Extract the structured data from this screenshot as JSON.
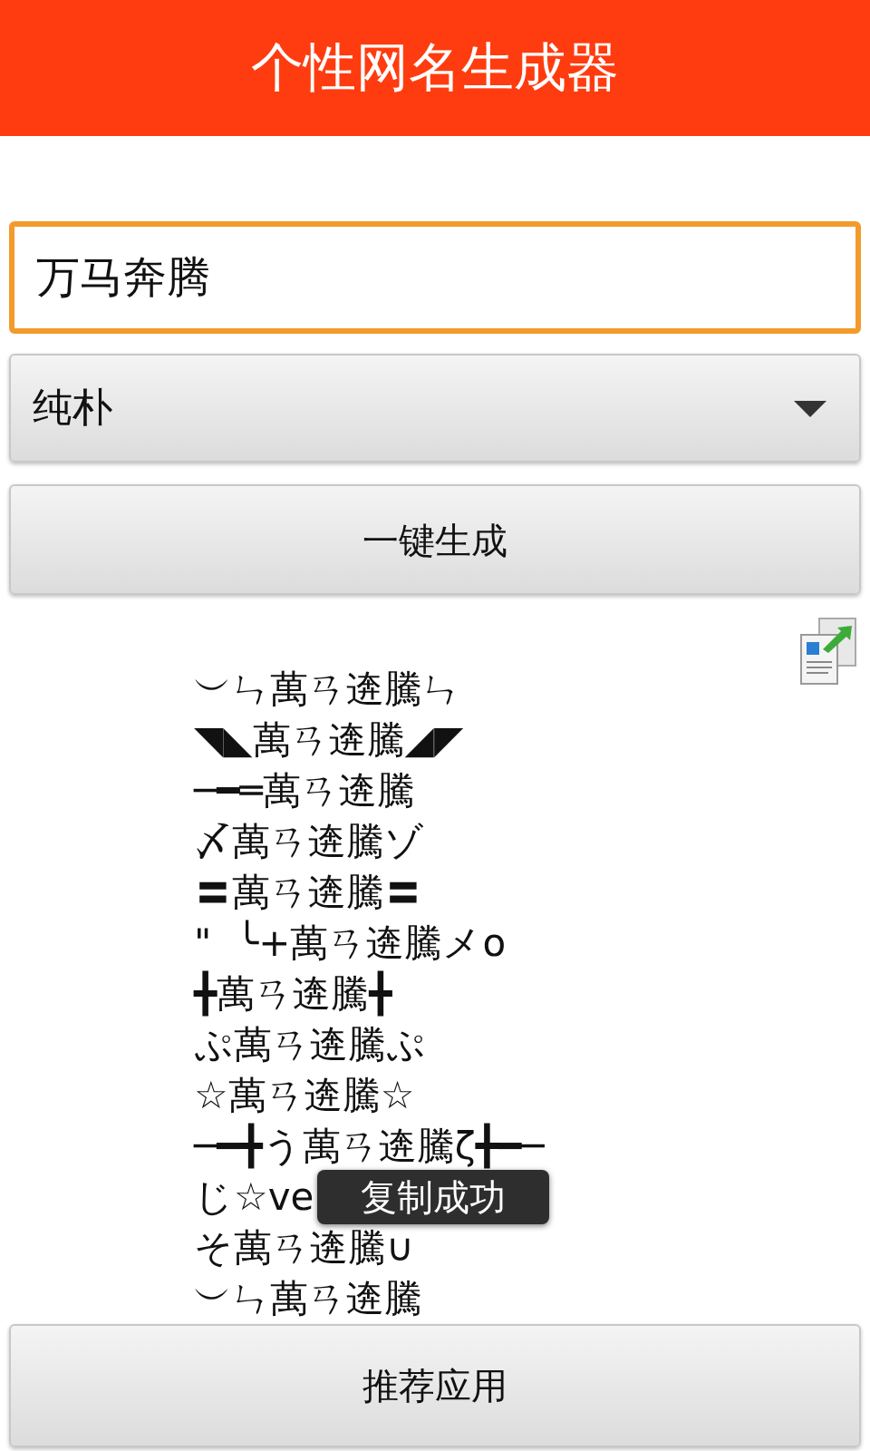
{
  "app_bar": {
    "title": "个性网名生成器"
  },
  "name_field": {
    "value": "万马奔腾"
  },
  "style_select": {
    "value": "纯朴"
  },
  "generate_button": "一键生成",
  "names": [
    "︶ㄣ萬ㄢ逩騰ㄣ",
    "◥◣萬ㄢ逩騰◢◤",
    "─━═萬ㄢ逩騰",
    "〆萬ㄢ逩騰ゾ",
    "〓萬ㄢ逩騰〓",
    "\"  ╰+萬ㄢ逩騰メo",
    "╋萬ㄢ逩騰╋",
    "ぷ萬ㄢ逩騰ぷ",
    "☆萬ㄢ逩騰☆",
    "─━╋う萬ㄢ逩騰ζ╋━─",
    "じ☆ve",
    "そ萬ㄢ逩騰∪",
    "︶ㄣ萬ㄢ逩騰"
  ],
  "toast": "复制成功",
  "bottom_button": "推荐应用"
}
